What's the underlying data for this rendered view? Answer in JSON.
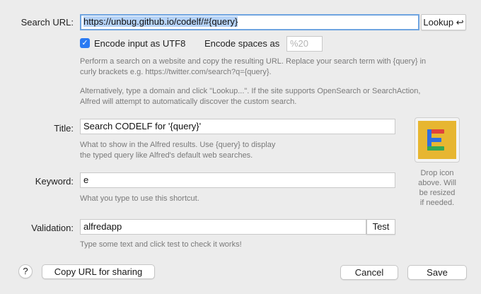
{
  "search_url": {
    "label": "Search URL:",
    "value": "https://unbug.github.io/codelf/#{query}",
    "lookup_label": "Lookup",
    "lookup_glyph": "↩"
  },
  "encode": {
    "utf8_label": "Encode input as UTF8",
    "utf8_checked": true,
    "spaces_label": "Encode spaces as",
    "spaces_placeholder": "%20"
  },
  "help": {
    "search_1": "Perform a search on a website and copy the resulting URL. Replace your search term with {query} in",
    "search_2": "curly brackets e.g. https://twitter.com/search?q={query}.",
    "lookup_1": "Alternatively, type a domain and click \"Lookup...\". If the site supports OpenSearch or SearchAction,",
    "lookup_2": "Alfred will attempt to automatically discover the custom search.",
    "title_1": "What to show in the Alfred results. Use {query} to display",
    "title_2": "the typed query like Alfred's default web searches.",
    "keyword": "What you type to use this shortcut.",
    "validation": "Type some text and click test to check it works!"
  },
  "title": {
    "label": "Title:",
    "value": "Search CODELF for '{query}'"
  },
  "keyword": {
    "label": "Keyword:",
    "value": "e"
  },
  "validation": {
    "label": "Validation:",
    "value": "alfredapp",
    "test_label": "Test"
  },
  "icon": {
    "name": "codelf-icon",
    "hint_1": "Drop icon",
    "hint_2": "above. Will",
    "hint_3": "be resized",
    "hint_4": "if needed."
  },
  "footer": {
    "help_label": "?",
    "copy_label": "Copy URL for sharing",
    "cancel_label": "Cancel",
    "save_label": "Save"
  },
  "colors": {
    "accent": "#2a7af3",
    "selection": "#b6d3f7",
    "icon_bg": "#e7b631",
    "icon_red": "#e0433b",
    "icon_blue": "#2f6fe0",
    "icon_green": "#34a853"
  }
}
